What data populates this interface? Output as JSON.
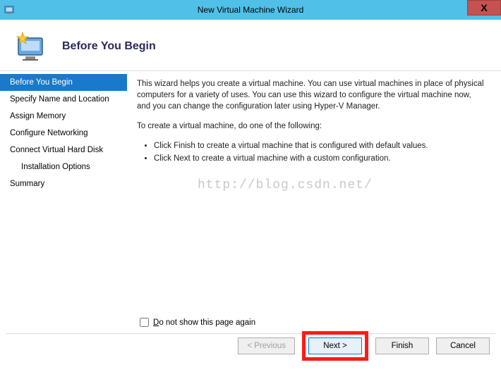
{
  "titlebar": {
    "title": "New Virtual Machine Wizard",
    "close": "X"
  },
  "header": {
    "title": "Before You Begin"
  },
  "sidebar": {
    "items": [
      {
        "label": "Before You Begin",
        "selected": true
      },
      {
        "label": "Specify Name and Location"
      },
      {
        "label": "Assign Memory"
      },
      {
        "label": "Configure Networking"
      },
      {
        "label": "Connect Virtual Hard Disk"
      },
      {
        "label": "Installation Options",
        "indent": true
      },
      {
        "label": "Summary"
      }
    ]
  },
  "main": {
    "intro": "This wizard helps you create a virtual machine. You can use virtual machines in place of physical computers for a variety of uses. You can use this wizard to configure the virtual machine now, and you can change the configuration later using Hyper-V Manager.",
    "prompt": "To create a virtual machine, do one of the following:",
    "bullets": [
      "Click Finish to create a virtual machine that is configured with default values.",
      "Click Next to create a virtual machine with a custom configuration."
    ],
    "watermark": "http://blog.csdn.net/",
    "checkbox_label": "Do not show this page again"
  },
  "buttons": {
    "previous": "< Previous",
    "next": "Next >",
    "finish": "Finish",
    "cancel": "Cancel"
  }
}
